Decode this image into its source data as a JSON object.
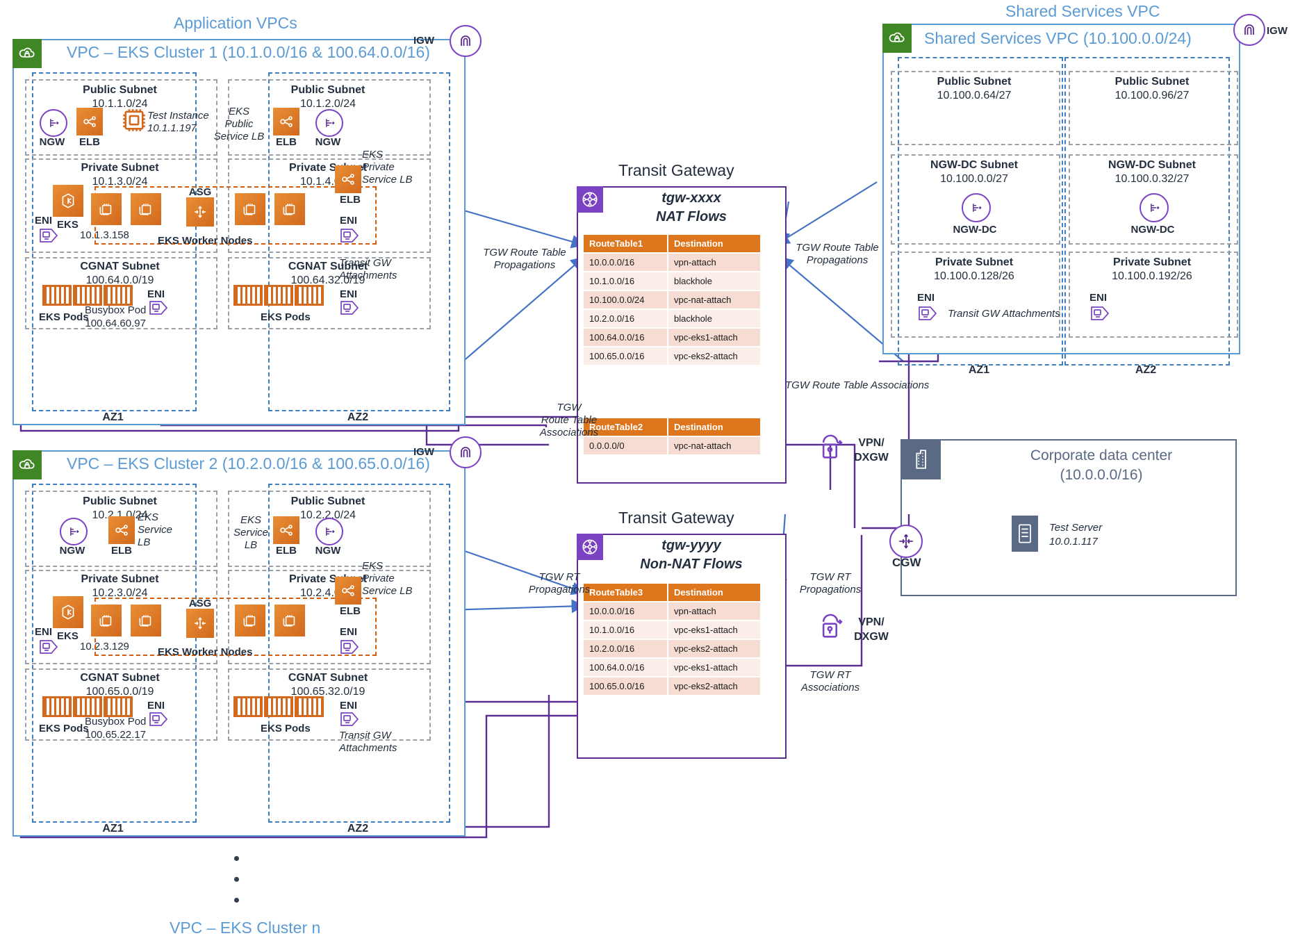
{
  "groups": {
    "application_vpcs": "Application VPCs",
    "shared_services": "Shared Services VPC",
    "cluster_n": "VPC – EKS Cluster n"
  },
  "vpc1": {
    "title": "VPC – EKS Cluster 1 (10.1.0.0/16 & 100.64.0.0/16)",
    "igw": "IGW",
    "az1": "AZ1",
    "az2": "AZ2",
    "public1": {
      "name": "Public Subnet",
      "cidr": "10.1.1.0/24",
      "ngw": "NGW",
      "elb": "ELB",
      "instance": "Test Instance\n10.1.1.197"
    },
    "public2": {
      "name": "Public Subnet",
      "cidr": "10.1.2.0/24",
      "ngw": "NGW",
      "elb": "ELB",
      "lb_label": "EKS\nPublic\nService LB"
    },
    "private1": {
      "name": "Private Subnet",
      "cidr": "10.1.3.0/24",
      "eks": "EKS",
      "eks_ip": "10.1.3.158",
      "eni": "ENI"
    },
    "private2": {
      "name": "Private Subnet",
      "cidr": "10.1.4.0/24",
      "eni": "ENI"
    },
    "asg": "ASG",
    "worker_nodes": "EKS Worker Nodes",
    "private_lb": {
      "label": "EKS\nPrivate\nService LB",
      "elb": "ELB"
    },
    "cgnat1": {
      "name": "CGNAT Subnet",
      "cidr": "100.64.0.0/19",
      "pods": "EKS Pods",
      "busybox": "Busybox Pod\n100.64.60.97",
      "eni": "ENI"
    },
    "cgnat2": {
      "name": "CGNAT Subnet",
      "cidr": "100.64.32.0/19",
      "pods": "EKS Pods",
      "eni": "ENI"
    },
    "tgw_attach_label": "Transit GW\nAttachments"
  },
  "vpc2": {
    "title": "VPC – EKS Cluster 2 (10.2.0.0/16 & 100.65.0.0/16)",
    "igw": "IGW",
    "az1": "AZ1",
    "az2": "AZ2",
    "public1": {
      "name": "Public Subnet",
      "cidr": "10.2.1.0/24",
      "ngw": "NGW",
      "elb": "ELB",
      "lb_label": "EKS\nService\nLB"
    },
    "public2": {
      "name": "Public Subnet",
      "cidr": "10.2.2.0/24",
      "ngw": "NGW",
      "elb": "ELB",
      "lb_label": "EKS\nService\nLB"
    },
    "private1": {
      "name": "Private Subnet",
      "cidr": "10.2.3.0/24",
      "eks": "EKS",
      "eks_ip": "10.2.3.129",
      "eni": "ENI"
    },
    "private2": {
      "name": "Private Subnet",
      "cidr": "10.2.4.0/24",
      "eni": "ENI"
    },
    "asg": "ASG",
    "worker_nodes": "EKS Worker Nodes",
    "private_lb": {
      "label": "EKS\nPrivate\nService LB",
      "elb": "ELB"
    },
    "cgnat1": {
      "name": "CGNAT Subnet",
      "cidr": "100.65.0.0/19",
      "pods": "EKS Pods",
      "busybox": "Busybox Pod\n100.65.22.17",
      "eni": "ENI"
    },
    "cgnat2": {
      "name": "CGNAT Subnet",
      "cidr": "100.65.32.0/19",
      "pods": "EKS Pods",
      "eni": "ENI"
    },
    "tgw_attach_label": "Transit GW\nAttachments"
  },
  "shared_vpc": {
    "title": "Shared Services VPC  (10.100.0.0/24)",
    "igw": "IGW",
    "az1": "AZ1",
    "az2": "AZ2",
    "public1": {
      "name": "Public Subnet",
      "cidr": "10.100.0.64/27"
    },
    "public2": {
      "name": "Public Subnet",
      "cidr": "10.100.0.96/27"
    },
    "ngwdc1": {
      "name": "NGW-DC Subnet",
      "cidr": "10.100.0.0/27",
      "label": "NGW-DC"
    },
    "ngwdc2": {
      "name": "NGW-DC Subnet",
      "cidr": "10.100.0.32/27",
      "label": "NGW-DC"
    },
    "private1": {
      "name": "Private Subnet",
      "cidr": "10.100.0.128/26",
      "eni": "ENI"
    },
    "private2": {
      "name": "Private Subnet",
      "cidr": "10.100.0.192/26",
      "eni": "ENI"
    },
    "tgw_attach_label": "Transit GW Attachments"
  },
  "tgw1": {
    "heading": "Transit Gateway",
    "id": "tgw-xxxx",
    "flows": "NAT Flows",
    "table1": {
      "headers": [
        "RouteTable1",
        "Destination"
      ],
      "rows": [
        [
          "10.0.0.0/16",
          "vpn-attach"
        ],
        [
          "10.1.0.0/16",
          "blackhole"
        ],
        [
          "10.100.0.0/24",
          "vpc-nat-attach"
        ],
        [
          "10.2.0.0/16",
          "blackhole"
        ],
        [
          "100.64.0.0/16",
          "vpc-eks1-attach"
        ],
        [
          "100.65.0.0/16",
          "vpc-eks2-attach"
        ]
      ]
    },
    "table2": {
      "headers": [
        "RouteTable2",
        "Destination"
      ],
      "rows": [
        [
          "0.0.0.0/0",
          "vpc-nat-attach"
        ]
      ]
    }
  },
  "tgw2": {
    "heading": "Transit Gateway",
    "id": "tgw-yyyy",
    "flows": "Non-NAT Flows",
    "table3": {
      "headers": [
        "RouteTable3",
        "Destination"
      ],
      "rows": [
        [
          "10.0.0.0/16",
          "vpn-attach"
        ],
        [
          "10.1.0.0/16",
          "vpc-eks1-attach"
        ],
        [
          "10.2.0.0/16",
          "vpc-eks2-attach"
        ],
        [
          "100.64.0.0/16",
          "vpc-eks1-attach"
        ],
        [
          "100.65.0.0/16",
          "vpc-eks2-attach"
        ]
      ]
    }
  },
  "annotations": {
    "prop_left_1": "TGW Route Table\nPropagations",
    "prop_right_1": "TGW Route Table\nPropagations",
    "assoc_left": "TGW\nRoute Table\nAssociations",
    "assoc_right": "TGW Route Table Associations",
    "prop_left_2": "TGW RT\nPropagations",
    "prop_right_2": "TGW RT\nPropagations",
    "assoc_right_2": "TGW RT\nAssociations"
  },
  "datacenter": {
    "title": "Corporate data center\n(10.0.0.0/16)",
    "test_server": "Test Server\n10.0.1.117",
    "cgw": "CGW",
    "vpn_top": "VPN/\nDXGW",
    "vpn_mid": "VPN/\nDXGW",
    "vpn_bottom": "VPN/\nDXGW"
  },
  "colors": {
    "vpc_blue": "#5b9bd5",
    "purple": "#5c2d91",
    "orange": "#dd761c",
    "green": "#3f8624",
    "slate": "#5a6a85"
  }
}
